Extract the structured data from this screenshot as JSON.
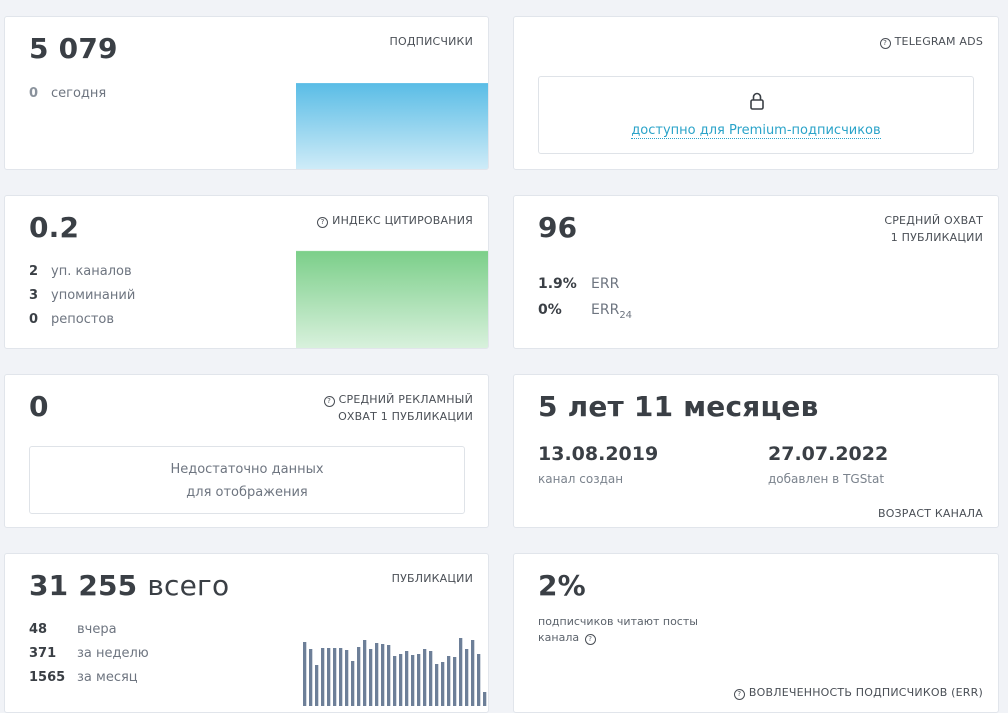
{
  "subscribers": {
    "value": "5 079",
    "label": "ПОДПИСЧИКИ",
    "today_count": "0",
    "today_label": "сегодня"
  },
  "telegram_ads": {
    "label": "TELEGRAM ADS",
    "premium_text": "доступно для Premium-подписчиков",
    "icon": "lock-icon"
  },
  "citation": {
    "value": "0.2",
    "label": "ИНДЕКС ЦИТИРОВАНИЯ",
    "stats": [
      {
        "count": "2",
        "label": "уп. каналов"
      },
      {
        "count": "3",
        "label": "упоминаний"
      },
      {
        "count": "0",
        "label": "репостов"
      }
    ]
  },
  "avg_reach": {
    "value": "96",
    "label_line1": "СРЕДНИЙ ОХВАТ",
    "label_line2": "1 ПУБЛИКАЦИИ",
    "err_value": "1.9%",
    "err_label": "ERR",
    "err24_value": "0%",
    "err24_label": "ERR",
    "err24_sub": "24"
  },
  "ad_reach": {
    "value": "0",
    "label_line1": "СРЕДНИЙ РЕКЛАМНЫЙ",
    "label_line2": "ОХВАТ 1 ПУБЛИКАЦИИ",
    "empty_line1": "Недостаточно данных",
    "empty_line2": "для отображения"
  },
  "channel_age": {
    "value": "5 лет 11 месяцев",
    "created_date": "13.08.2019",
    "created_label": "канал создан",
    "added_date": "27.07.2022",
    "added_label": "добавлен в TGStat",
    "label": "ВОЗРАСТ КАНАЛА"
  },
  "publications": {
    "value_num": "31 255",
    "value_word": "всего",
    "label": "ПУБЛИКАЦИИ",
    "stats": [
      {
        "count": "48",
        "label": "вчера"
      },
      {
        "count": "371",
        "label": "за неделю"
      },
      {
        "count": "1565",
        "label": "за месяц"
      }
    ]
  },
  "engagement": {
    "value": "2%",
    "text_line1": "подписчиков читают посты",
    "text_line2": "канала",
    "label": "ВОВЛЕЧЕННОСТЬ ПОДПИСЧИКОВ (ERR)"
  },
  "colors": {
    "subscribers_chart": "#8fd0ee",
    "citation_chart": "#9fdcab",
    "pub_bars": "#6d7f98"
  },
  "chart_data": [
    {
      "type": "area",
      "chart": "subscribers",
      "values": [
        1,
        1,
        1,
        1,
        1,
        1,
        1,
        1,
        1,
        1
      ],
      "ylim": [
        0,
        1.15
      ]
    },
    {
      "type": "area",
      "chart": "citation",
      "values": [
        1,
        1,
        1,
        1,
        1,
        1,
        1,
        1,
        1,
        1
      ],
      "ylim": [
        0,
        1.1
      ]
    },
    {
      "type": "bar",
      "chart": "publications",
      "values": [
        64,
        57,
        41,
        58,
        58,
        58,
        58,
        56,
        45,
        59,
        66,
        57,
        63,
        62,
        61,
        50,
        52,
        55,
        51,
        52,
        57,
        55,
        42,
        44,
        50,
        49,
        68,
        57,
        66,
        52,
        14
      ],
      "ylim": [
        0,
        72
      ]
    }
  ]
}
